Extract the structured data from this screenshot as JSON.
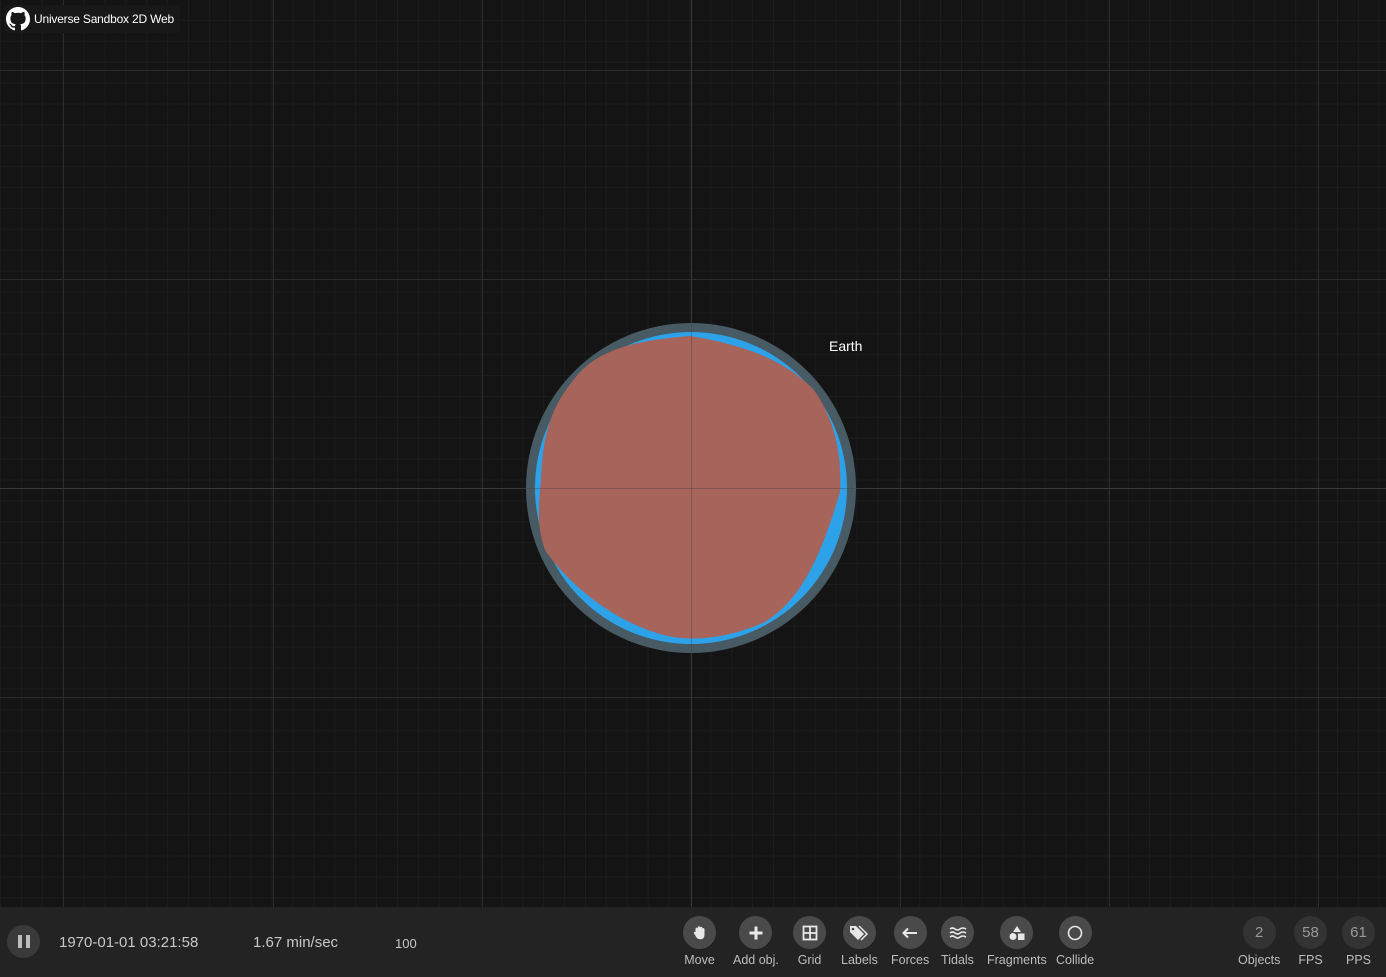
{
  "app": {
    "title": "Universe Sandbox 2D Web"
  },
  "canvas": {
    "body_label": "Earth",
    "colors": {
      "background": "#141414",
      "atmosphere": "#485a64",
      "ocean": "#2ea2e8",
      "land": "#a6645a"
    }
  },
  "status": {
    "date": "1970-01-01 03:21:58",
    "speed": "1.67 min/sec",
    "value": "100"
  },
  "tools": {
    "move": "Move",
    "add": "Add obj.",
    "grid": "Grid",
    "labels": "Labels",
    "forces": "Forces",
    "tidals": "Tidals",
    "fragments": "Fragments",
    "collide": "Collide"
  },
  "stats": {
    "objects_value": "2",
    "objects_label": "Objects",
    "fps_value": "58",
    "fps_label": "FPS",
    "pps_value": "61",
    "pps_label": "PPS"
  }
}
